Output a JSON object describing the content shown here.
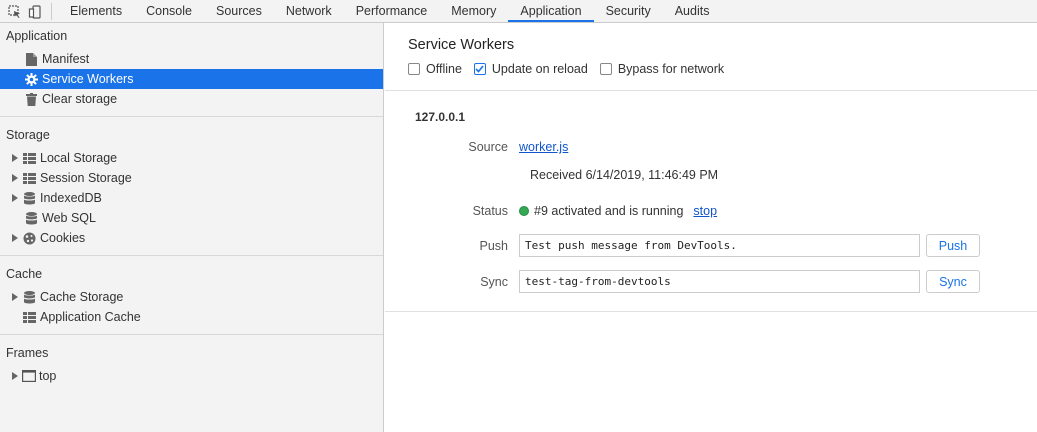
{
  "toolbar": {
    "icons": [
      "inspect-icon",
      "device-toggle-icon"
    ],
    "tabs": [
      "Elements",
      "Console",
      "Sources",
      "Network",
      "Performance",
      "Memory",
      "Application",
      "Security",
      "Audits"
    ],
    "active_tab": "Application"
  },
  "sidebar": {
    "application": {
      "title": "Application",
      "items": [
        {
          "label": "Manifest",
          "icon": "document-icon"
        },
        {
          "label": "Service Workers",
          "icon": "gear-icon",
          "selected": true
        },
        {
          "label": "Clear storage",
          "icon": "trash-icon"
        }
      ]
    },
    "storage": {
      "title": "Storage",
      "items": [
        {
          "label": "Local Storage",
          "icon": "grid-icon",
          "expandable": true
        },
        {
          "label": "Session Storage",
          "icon": "grid-icon",
          "expandable": true
        },
        {
          "label": "IndexedDB",
          "icon": "database-icon",
          "expandable": true
        },
        {
          "label": "Web SQL",
          "icon": "database-icon",
          "expandable": false
        },
        {
          "label": "Cookies",
          "icon": "cookie-icon",
          "expandable": true
        }
      ]
    },
    "cache": {
      "title": "Cache",
      "items": [
        {
          "label": "Cache Storage",
          "icon": "database-icon",
          "expandable": true
        },
        {
          "label": "Application Cache",
          "icon": "grid-icon",
          "expandable": false
        }
      ]
    },
    "frames": {
      "title": "Frames",
      "items": [
        {
          "label": "top",
          "icon": "frame-icon",
          "expandable": true
        }
      ]
    }
  },
  "main": {
    "title": "Service Workers",
    "options": {
      "offline": {
        "label": "Offline",
        "checked": false
      },
      "update_on_reload": {
        "label": "Update on reload",
        "checked": true
      },
      "bypass": {
        "label": "Bypass for network",
        "checked": false
      }
    },
    "worker": {
      "origin": "127.0.0.1",
      "source_label": "Source",
      "source_link": "worker.js",
      "received": "Received 6/14/2019, 11:46:49 PM",
      "status_label": "Status",
      "status_text": "#9 activated and is running",
      "status_color": "#34a853",
      "stop_link": "stop",
      "push_label": "Push",
      "push_value": "Test push message from DevTools.",
      "push_button": "Push",
      "sync_label": "Sync",
      "sync_value": "test-tag-from-devtools",
      "sync_button": "Sync"
    }
  }
}
